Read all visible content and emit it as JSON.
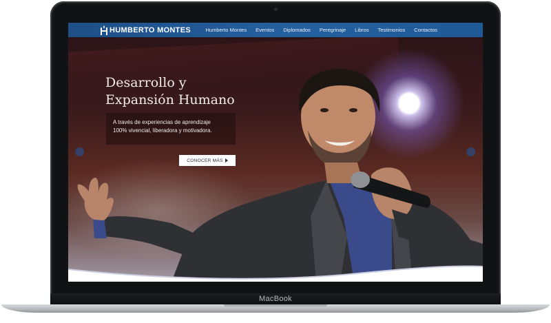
{
  "site": {
    "logo_text": "HUMBERTO MONTES",
    "nav": [
      "Humberto Montes",
      "Eventos",
      "Diplomados",
      "Peregrinaje",
      "Libros",
      "Testimonios",
      "Contactos"
    ]
  },
  "hero": {
    "title_line1": "Desarrollo y",
    "title_line2": "Expansión Humano",
    "subtitle_line1": "A través de experiencias de aprendizaje",
    "subtitle_line2": "100% vivencial, liberadora y motivadora.",
    "cta_label": "CONOCER MÁS"
  },
  "device": {
    "label": "MacBook"
  },
  "colors": {
    "nav": "#2460a0",
    "cta_bg": "#ffffff",
    "title": "#f2ece6"
  }
}
